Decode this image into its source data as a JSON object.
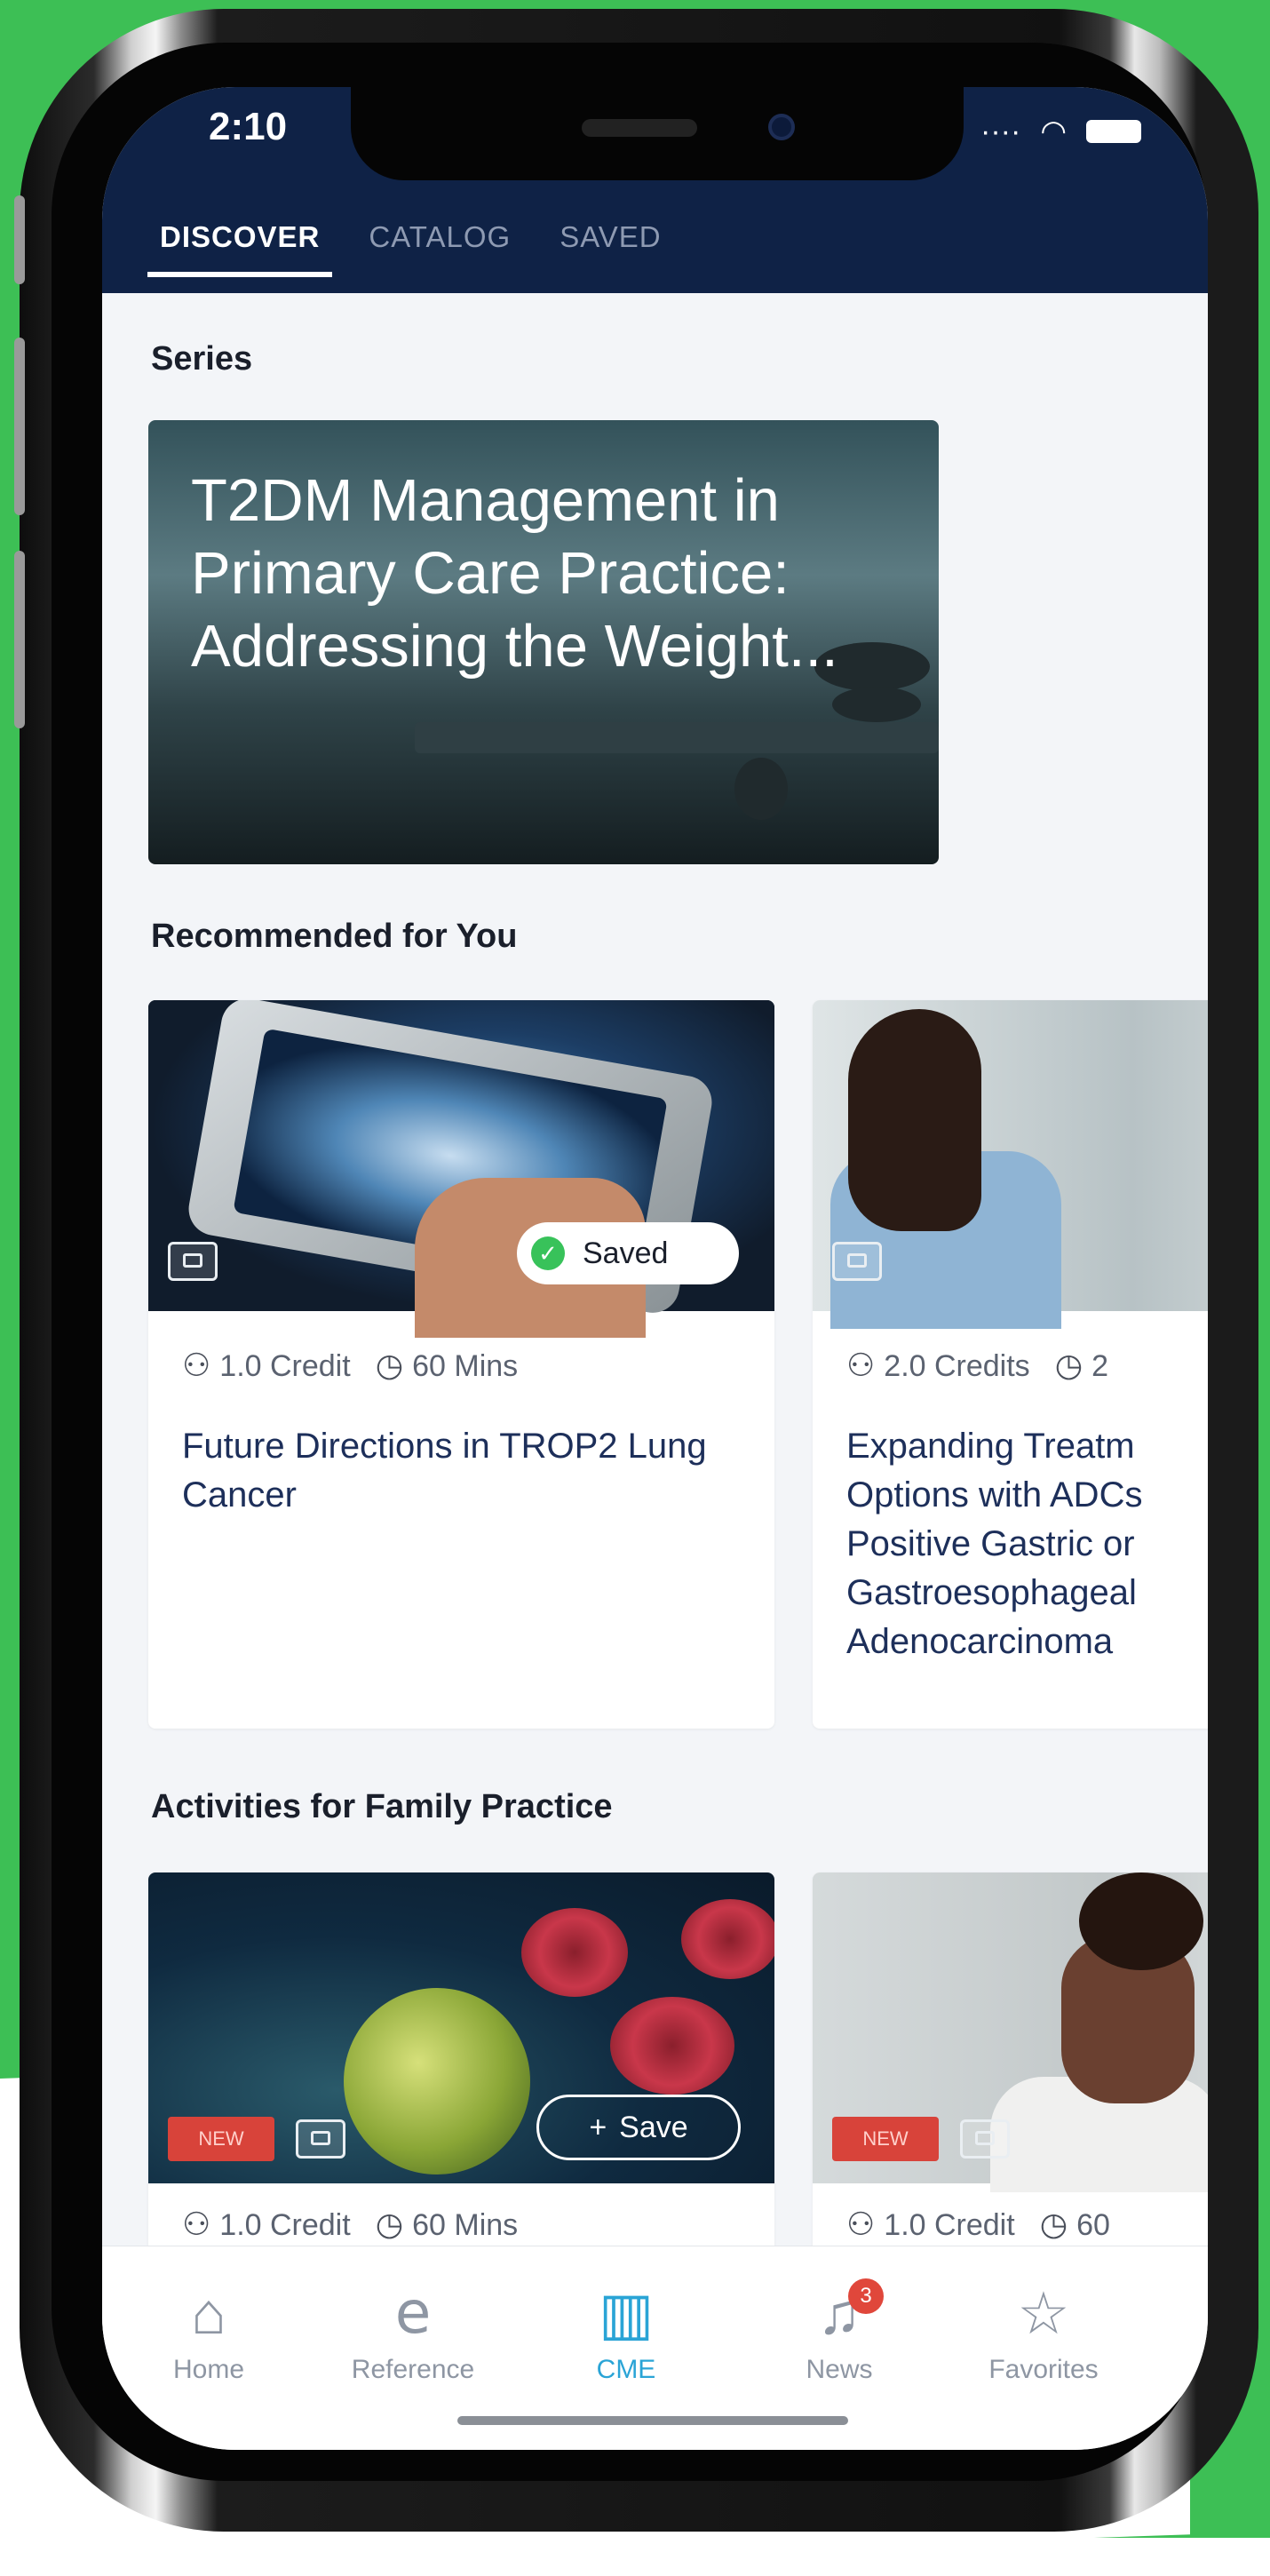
{
  "status_bar": {
    "time": "2:10"
  },
  "tabs": [
    {
      "label": "DISCOVER",
      "active": true
    },
    {
      "label": "CATALOG",
      "active": false
    },
    {
      "label": "SAVED",
      "active": false
    }
  ],
  "series": {
    "heading": "Series",
    "card_title": "T2DM Management in Primary Care Practice: Addressing the Weight..."
  },
  "recommended": {
    "heading": "Recommended for You",
    "cards": [
      {
        "credits": "1.0 Credit",
        "duration": "60 Mins",
        "title": "Future Directions in TROP2 Lung Cancer",
        "saved_label": "Saved"
      },
      {
        "credits": "2.0 Credits",
        "duration": "2",
        "title": "Expanding Treatm Options with ADCs Positive Gastric or Gastroesophageal Adenocarcinoma"
      }
    ]
  },
  "family_practice": {
    "heading": "Activities for Family Practice",
    "cards": [
      {
        "badge": "NEW",
        "save_label": "Save",
        "credits": "1.0 Credit",
        "duration": "60 Mins"
      },
      {
        "badge": "NEW",
        "credits": "1.0 Credit",
        "duration": "60"
      }
    ]
  },
  "bottom_nav": [
    {
      "label": "Home",
      "icon": "home-icon"
    },
    {
      "label": "Reference",
      "icon": "reference-icon"
    },
    {
      "label": "CME",
      "icon": "cme-icon",
      "active": true
    },
    {
      "label": "News",
      "icon": "bell-icon",
      "badge": "3"
    },
    {
      "label": "Favorites",
      "icon": "star-icon"
    }
  ],
  "colors": {
    "header": "#0f2246",
    "accent": "#2aa4d6",
    "background": "#3dbf55",
    "badge": "#e0473b"
  }
}
